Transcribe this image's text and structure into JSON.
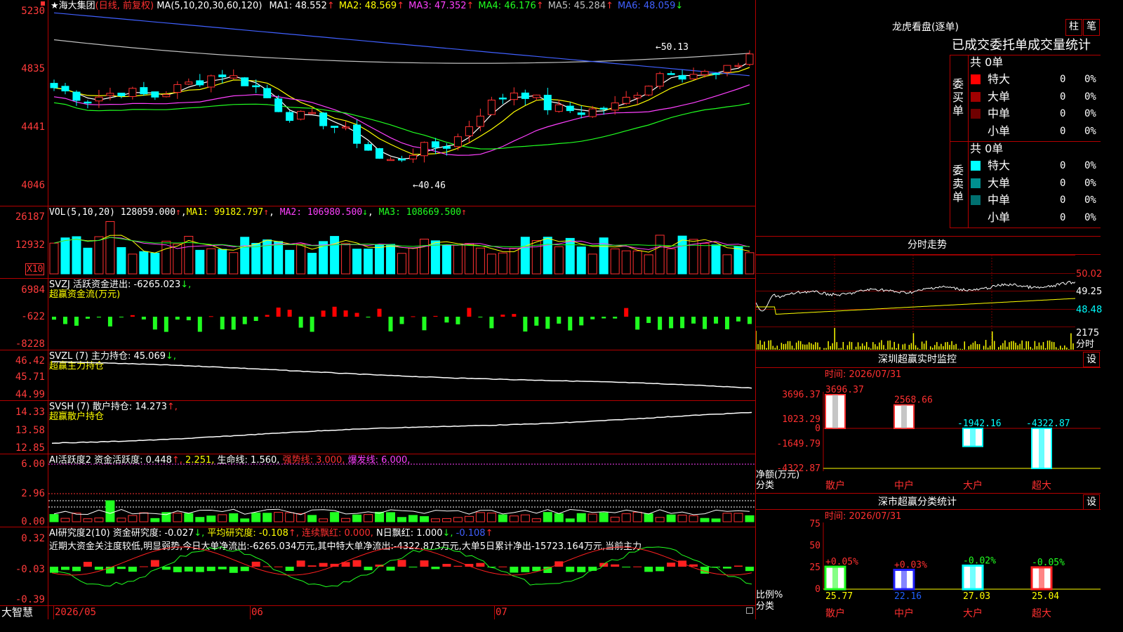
{
  "stock": {
    "name": "★海大集团",
    "mode": "(日线, 前复权)"
  },
  "main": {
    "ma_param": "MA(5,10,20,30,60,120)",
    "ma": [
      {
        "label": "MA1: 48.552",
        "arrow": "↑",
        "color": "#ffffff"
      },
      {
        "label": "MA2: 48.569",
        "arrow": "↑",
        "color": "#ffff00"
      },
      {
        "label": "MA3: 47.352",
        "arrow": "↑",
        "color": "#ff40ff"
      },
      {
        "label": "MA4: 46.176",
        "arrow": "↑",
        "color": "#20ff20"
      },
      {
        "label": "MA5: 45.284",
        "arrow": "↑",
        "color": "#c0c0c0"
      },
      {
        "label": "MA6: 48.059",
        "arrow": "↓",
        "color": "#4060ff"
      }
    ],
    "y_ticks": [
      "5230",
      "4835",
      "4441",
      "4046"
    ],
    "high_label": "50.13",
    "low_label": "40.46"
  },
  "vol": {
    "header": "VOL(5,10,20)",
    "value": "128059.000",
    "ma1": "MA1: 99182.797",
    "ma2": "MA2: 106980.500",
    "ma3": "MA3: 108669.500",
    "y_ticks": [
      "26187",
      "12932"
    ],
    "unit": "X10"
  },
  "svzj": {
    "name": "SVZJ",
    "label": "活跃资金进出: -6265.023",
    "arrow": "↓,",
    "sub": "超赢资金流(万元)",
    "y_ticks": [
      "6984",
      "-622",
      "-8228"
    ]
  },
  "svzl": {
    "name": "SVZL (7)",
    "label": "主力持仓: 45.069",
    "arrow": "↓,",
    "sub": "超赢主力持仓",
    "y_ticks": [
      "46.42",
      "45.71",
      "44.99"
    ]
  },
  "svsh": {
    "name": "SVSH (7)",
    "label": "散户持仓: 14.273",
    "arrow": "↑,",
    "sub": "超赢散户持仓",
    "y_ticks": [
      "14.33",
      "13.58",
      "12.85"
    ]
  },
  "ai_active": {
    "name": "AI活跃度2",
    "p1": "资金活跃度: 0.448",
    "p1_arrow": "↑,",
    "p2": "2.251,",
    "p3": "生命线: 1.560,",
    "p4": "强势线: 3.000,",
    "p5": "爆发线: 6.000,",
    "y_ticks": [
      "6.00",
      "2.96",
      "0.00"
    ]
  },
  "ai_research": {
    "name": "AI研究度2(10)",
    "p1": "资金研究度: -0.027",
    "p1_arrow": "↓,",
    "p2": "平均研究度: -0.108",
    "p2_arrow": "↑,",
    "p3": "连续飘红: 0.000,",
    "p4": "N日飘红: 1.000",
    "p4_arrow": "↓,",
    "p5": "-0.108",
    "p5_arrow": "↑",
    "comment": "近期大资金关注度较低,明显弱势,今日大单净流出:-6265.034万元,其中特大单净流出:-4322.873万元,大单5日累计净出-15723.164万元,当前主力",
    "y_ticks": [
      "0.32",
      "-0.03",
      "-0.39"
    ]
  },
  "xaxis": {
    "brand": "大智慧",
    "labels": [
      "2026/05",
      "06",
      "07"
    ]
  },
  "lhb": {
    "title": "龙虎看盘(逐单)",
    "btn_bar": "柱",
    "btn_pen": "笔",
    "tabs_text": "已成交委托单成交量统计",
    "buy": {
      "side": "委买单",
      "total": "共 0单",
      "rows": [
        {
          "name": "特大",
          "val": "0",
          "pct": "0%",
          "color": "#ff0000"
        },
        {
          "name": "大单",
          "val": "0",
          "pct": "0%",
          "color": "#a00000"
        },
        {
          "name": "中单",
          "val": "0",
          "pct": "0%",
          "color": "#700000"
        },
        {
          "name": "小单",
          "val": "0",
          "pct": "0%",
          "color": ""
        }
      ]
    },
    "sell": {
      "side": "委卖单",
      "total": "共 0单",
      "rows": [
        {
          "name": "特大",
          "val": "0",
          "pct": "0%",
          "color": "#00ffff"
        },
        {
          "name": "大单",
          "val": "0",
          "pct": "0%",
          "color": "#009090"
        },
        {
          "name": "中单",
          "val": "0",
          "pct": "0%",
          "color": "#007070"
        },
        {
          "name": "小单",
          "val": "0",
          "pct": "0%",
          "color": ""
        }
      ]
    }
  },
  "intraday": {
    "title": "分时走势",
    "y_ticks": [
      "50.02",
      "49.25",
      "48.48"
    ],
    "vol_tick": "2175",
    "vol_unit": "分时"
  },
  "monitor": {
    "title": "深圳超赢实时监控",
    "set": "设",
    "time": "时间: 2026/07/31",
    "y_ticks": [
      "3696.37",
      "1023.29",
      "0",
      "-1649.79",
      "-4322.87"
    ],
    "axis_label": "净额(万元)",
    "axis_label2": "分类",
    "bars": [
      {
        "name": "散户",
        "value": 3696.37,
        "label": "3696.37"
      },
      {
        "name": "中户",
        "value": 2568.66,
        "label": "2568.66"
      },
      {
        "name": "大户",
        "value": -1942.16,
        "label": "-1942.16"
      },
      {
        "name": "超大",
        "value": -4322.87,
        "label": "-4322.87"
      }
    ]
  },
  "class_stats": {
    "title": "深市超赢分类统计",
    "set": "设",
    "time": "时间: 2026/07/31",
    "y_ticks": [
      "75",
      "50",
      "25",
      "0"
    ],
    "axis_label": "比例%",
    "axis_label2": "分类",
    "bars": [
      {
        "name": "散户",
        "ratio": 25.77,
        "ratio_label": "25.77",
        "change": "+0.05%"
      },
      {
        "name": "中户",
        "ratio": 22.16,
        "ratio_label": "22.16",
        "change": "+0.03%"
      },
      {
        "name": "大户",
        "ratio": 27.03,
        "ratio_label": "27.03",
        "change": "-0.02%"
      },
      {
        "name": "超大",
        "ratio": 25.04,
        "ratio_label": "25.04",
        "change": "-0.05%"
      }
    ]
  },
  "colors": {
    "up": "#ff3030",
    "down": "#00ffff",
    "border": "#b40000"
  }
}
